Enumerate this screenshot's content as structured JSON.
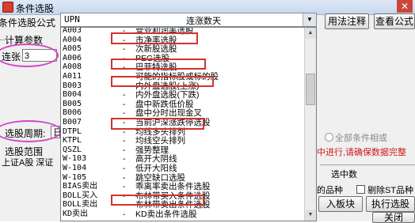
{
  "window": {
    "title": "条件选股"
  },
  "left": {
    "formula_label": "条件选股公式",
    "params_label": "计算参数",
    "param_name": "连张",
    "param_value": "3",
    "period_label": "选股周期:",
    "period_value": "日",
    "range_label": "选股范围",
    "range_value": "上证A股 深证"
  },
  "combo": {
    "code": "UPN",
    "name": "连涨数天"
  },
  "formulas": [
    {
      "code": "A003",
      "dash": "-",
      "name": "营业利润率选股"
    },
    {
      "code": "A004",
      "dash": "-",
      "name": "市净率选股"
    },
    {
      "code": "A005",
      "dash": "-",
      "name": "次新股选股"
    },
    {
      "code": "A006",
      "dash": "-",
      "name": "PEG选股"
    },
    {
      "code": "A008",
      "dash": "-",
      "name": "巴菲特选股"
    },
    {
      "code": "A011",
      "dash": "-",
      "name": "可能的指标股或标的股"
    },
    {
      "code": "B003",
      "dash": "-",
      "name": "内外盘选股(上涨)"
    },
    {
      "code": "B004",
      "dash": "-",
      "name": "内外盘选股(下跌)"
    },
    {
      "code": "B005",
      "dash": "-",
      "name": "盘中新跌低价股"
    },
    {
      "code": "B006",
      "dash": "-",
      "name": "盘中分时出现金叉"
    },
    {
      "code": "B007",
      "dash": "-",
      "name": "当前沪深涨跌停选股"
    },
    {
      "code": "DTPL",
      "dash": "-",
      "name": "均线多头排列"
    },
    {
      "code": "KTPL",
      "dash": "-",
      "name": "均线空头排列"
    },
    {
      "code": "QSZL",
      "dash": "-",
      "name": "强势整理"
    },
    {
      "code": "W-103",
      "dash": "-",
      "name": "高开大阴线"
    },
    {
      "code": "W-104",
      "dash": "-",
      "name": "低开大阳线"
    },
    {
      "code": "W-105",
      "dash": "-",
      "name": "跳空缺口选股"
    },
    {
      "code": "BIAS卖出",
      "dash": "-",
      "name": "乖离率卖出条件选股"
    },
    {
      "code": "BOLL买入",
      "dash": "-",
      "name": "布林带买入条件选股"
    },
    {
      "code": "BOLL卖出",
      "dash": "-",
      "name": "布林带卖出条件选股"
    },
    {
      "code": "KD卖出",
      "dash": "-",
      "name": "KD卖出条件选股"
    }
  ],
  "right": {
    "usage_button": "用法注释",
    "view_formula_button": "查看公式",
    "all_conditions_label": "全部条件相或",
    "warning_text": "中进行,请确保数据完整",
    "selected_count_label": "选中数",
    "varieties_label": "的品种",
    "exclude_st_label": "剔除ST品种",
    "add_block_button": "入板块",
    "run_button": "执行选股",
    "close_button": "关闭"
  }
}
